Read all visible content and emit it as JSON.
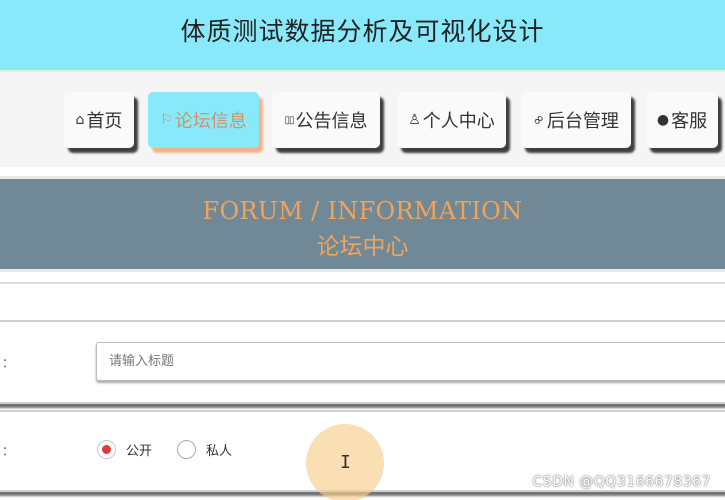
{
  "site": {
    "title": "体质测试数据分析及可视化设计"
  },
  "nav": {
    "items": [
      {
        "label": "首页",
        "icon": "home-icon",
        "glyph": "⌂"
      },
      {
        "label": "论坛信息",
        "icon": "flag-icon",
        "glyph": "⚐",
        "active": true
      },
      {
        "label": "公告信息",
        "icon": "book-icon",
        "glyph": "▯▯"
      },
      {
        "label": "个人中心",
        "icon": "user-icon",
        "glyph": "♙"
      },
      {
        "label": "后台管理",
        "icon": "link-icon",
        "glyph": "∞"
      },
      {
        "label": "客服",
        "icon": "chat-icon",
        "glyph": "●"
      }
    ]
  },
  "banner": {
    "en": "FORUM / INFORMATION",
    "cn": "论坛中心"
  },
  "form": {
    "title_label": "：",
    "title_placeholder": "请输入标题",
    "visibility_label": "：",
    "options": [
      {
        "label": "公开",
        "checked": true
      },
      {
        "label": "私人",
        "checked": false
      }
    ]
  },
  "watermark": "CSDN @QQ3166678367",
  "colors": {
    "header": "#88e9fb",
    "banner": "#718897",
    "accent": "#f0a45b",
    "radio": "#e0383b"
  }
}
